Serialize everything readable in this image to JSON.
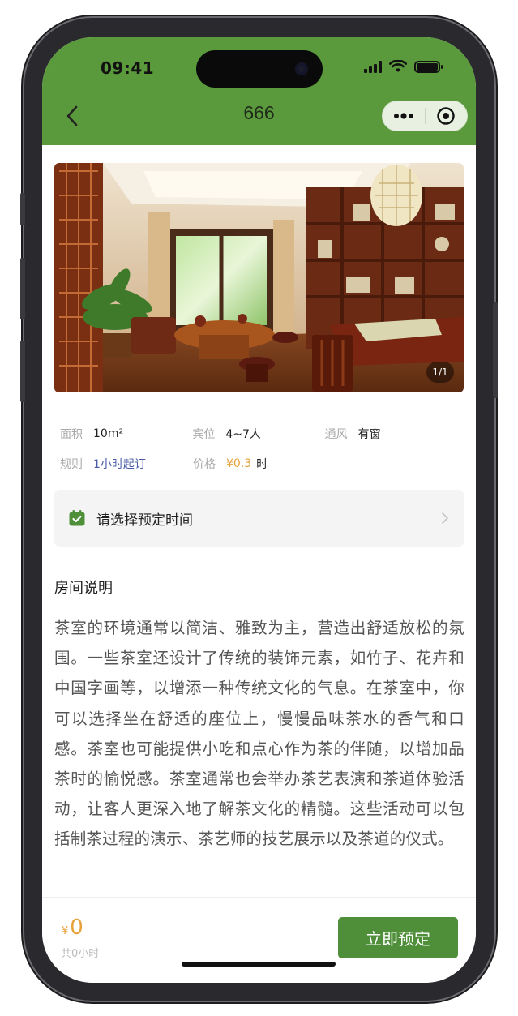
{
  "status_bar": {
    "time": "09:41"
  },
  "nav": {
    "title": "666",
    "back_icon": "chevron-left-icon",
    "more_icon": "more-dots-icon",
    "close_icon": "target-icon"
  },
  "colors": {
    "brand_green": "#5a9a3c",
    "button_green": "#4f8f3a",
    "price_orange": "#e8a23c",
    "link_blue": "#4a5ba8"
  },
  "gallery": {
    "counter": "1/1"
  },
  "info": {
    "area": {
      "label": "面积",
      "value": "10m²"
    },
    "capacity": {
      "label": "宾位",
      "value": "4~7人"
    },
    "ventilation": {
      "label": "通风",
      "value": "有窗"
    },
    "rule": {
      "label": "规则",
      "value": "1小时起订"
    },
    "price": {
      "label": "价格",
      "value": "¥0.3",
      "unit": "时"
    }
  },
  "time_select": {
    "label": "请选择预定时间"
  },
  "description": {
    "title": "房间说明",
    "text": "茶室的环境通常以简洁、雅致为主，营造出舒适放松的氛围。一些茶室还设计了传统的装饰元素，如竹子、花卉和中国字画等，以增添一种传统文化的气息。在茶室中，你可以选择坐在舒适的座位上，慢慢品味茶水的香气和口感。茶室也可能提供小吃和点心作为茶的伴随，以增加品茶时的愉悦感。茶室通常也会举办茶艺表演和茶道体验活动，让客人更深入地了解茶文化的精髓。这些活动可以包括制茶过程的演示、茶艺师的技艺展示以及茶道的仪式。"
  },
  "footer": {
    "currency": "¥",
    "total": "0",
    "hours_text": "共0小时",
    "book_label": "立即预定"
  }
}
